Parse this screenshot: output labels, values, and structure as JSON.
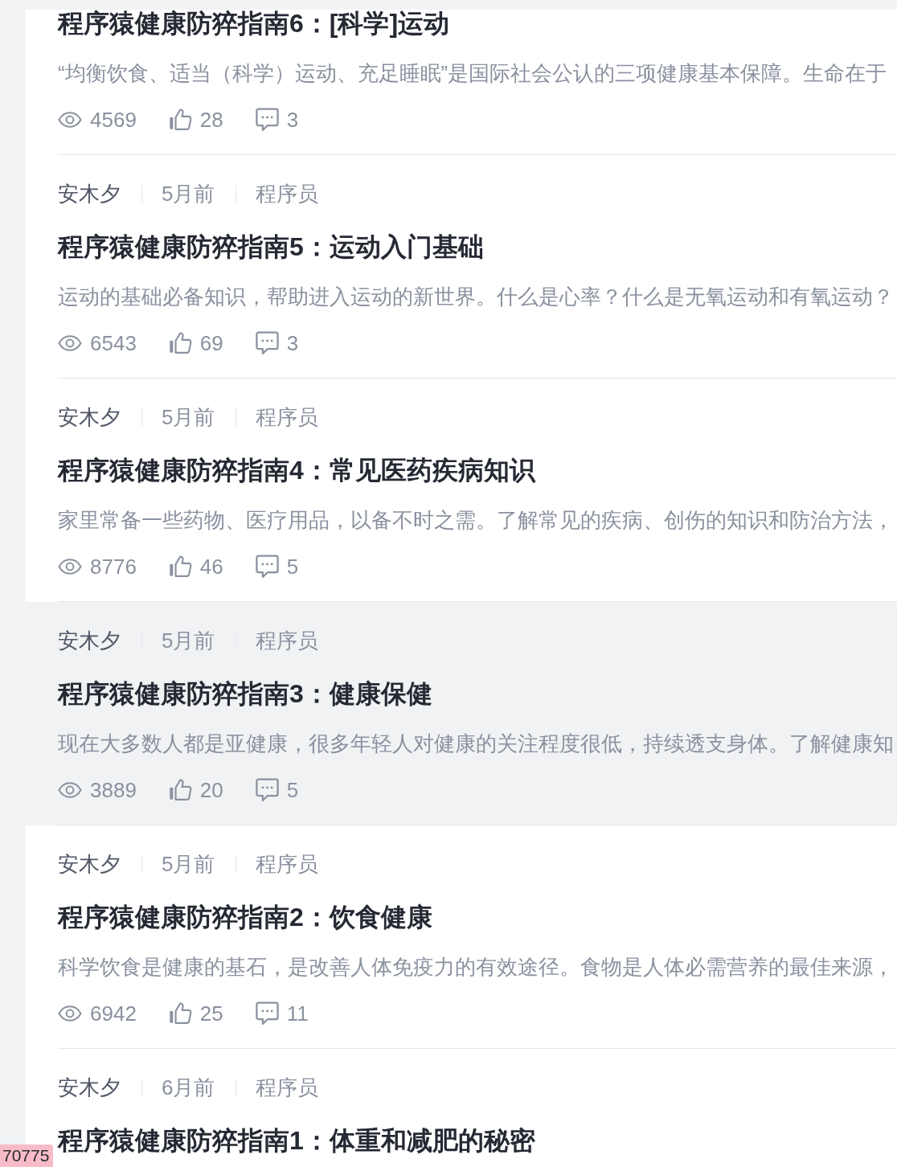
{
  "articles": [
    {
      "title": "程序猿健康防猝指南6：[科学]运动",
      "excerpt": "“均衡饮食、适当（科学）运动、充足睡眠”是国际社会公认的三项健康基本保障。生命在于",
      "views": "4569",
      "likes": "28",
      "comments": "3",
      "hovered": false
    },
    {
      "author": "安木夕",
      "time": "5月前",
      "tag": "程序员",
      "title": "程序猿健康防猝指南5：运动入门基础",
      "excerpt": "运动的基础必备知识，帮助进入运动的新世界。什么是心率？什么是无氧运动和有氧运动？",
      "views": "6543",
      "likes": "69",
      "comments": "3",
      "hovered": false
    },
    {
      "author": "安木夕",
      "time": "5月前",
      "tag": "程序员",
      "title": "程序猿健康防猝指南4：常见医药疾病知识",
      "excerpt": "家里常备一些药物、医疗用品，以备不时之需。了解常见的疾病、创伤的知识和防治方法，",
      "views": "8776",
      "likes": "46",
      "comments": "5",
      "hovered": false
    },
    {
      "author": "安木夕",
      "time": "5月前",
      "tag": "程序员",
      "title": "程序猿健康防猝指南3：健康保健",
      "excerpt": "现在大多数人都是亚健康，很多年轻人对健康的关注程度很低，持续透支身体。了解健康知",
      "views": "3889",
      "likes": "20",
      "comments": "5",
      "hovered": true
    },
    {
      "author": "安木夕",
      "time": "5月前",
      "tag": "程序员",
      "title": "程序猿健康防猝指南2：饮食健康",
      "excerpt": "科学饮食是健康的基石，是改善人体免疫力的有效途径。食物是人体必需营养的最佳来源，",
      "views": "6942",
      "likes": "25",
      "comments": "11",
      "hovered": false
    },
    {
      "author": "安木夕",
      "time": "6月前",
      "tag": "程序员",
      "title": "程序猿健康防猝指南1：体重和减肥的秘密",
      "hovered": false
    }
  ],
  "corner_badge": {
    "text": "70775"
  }
}
